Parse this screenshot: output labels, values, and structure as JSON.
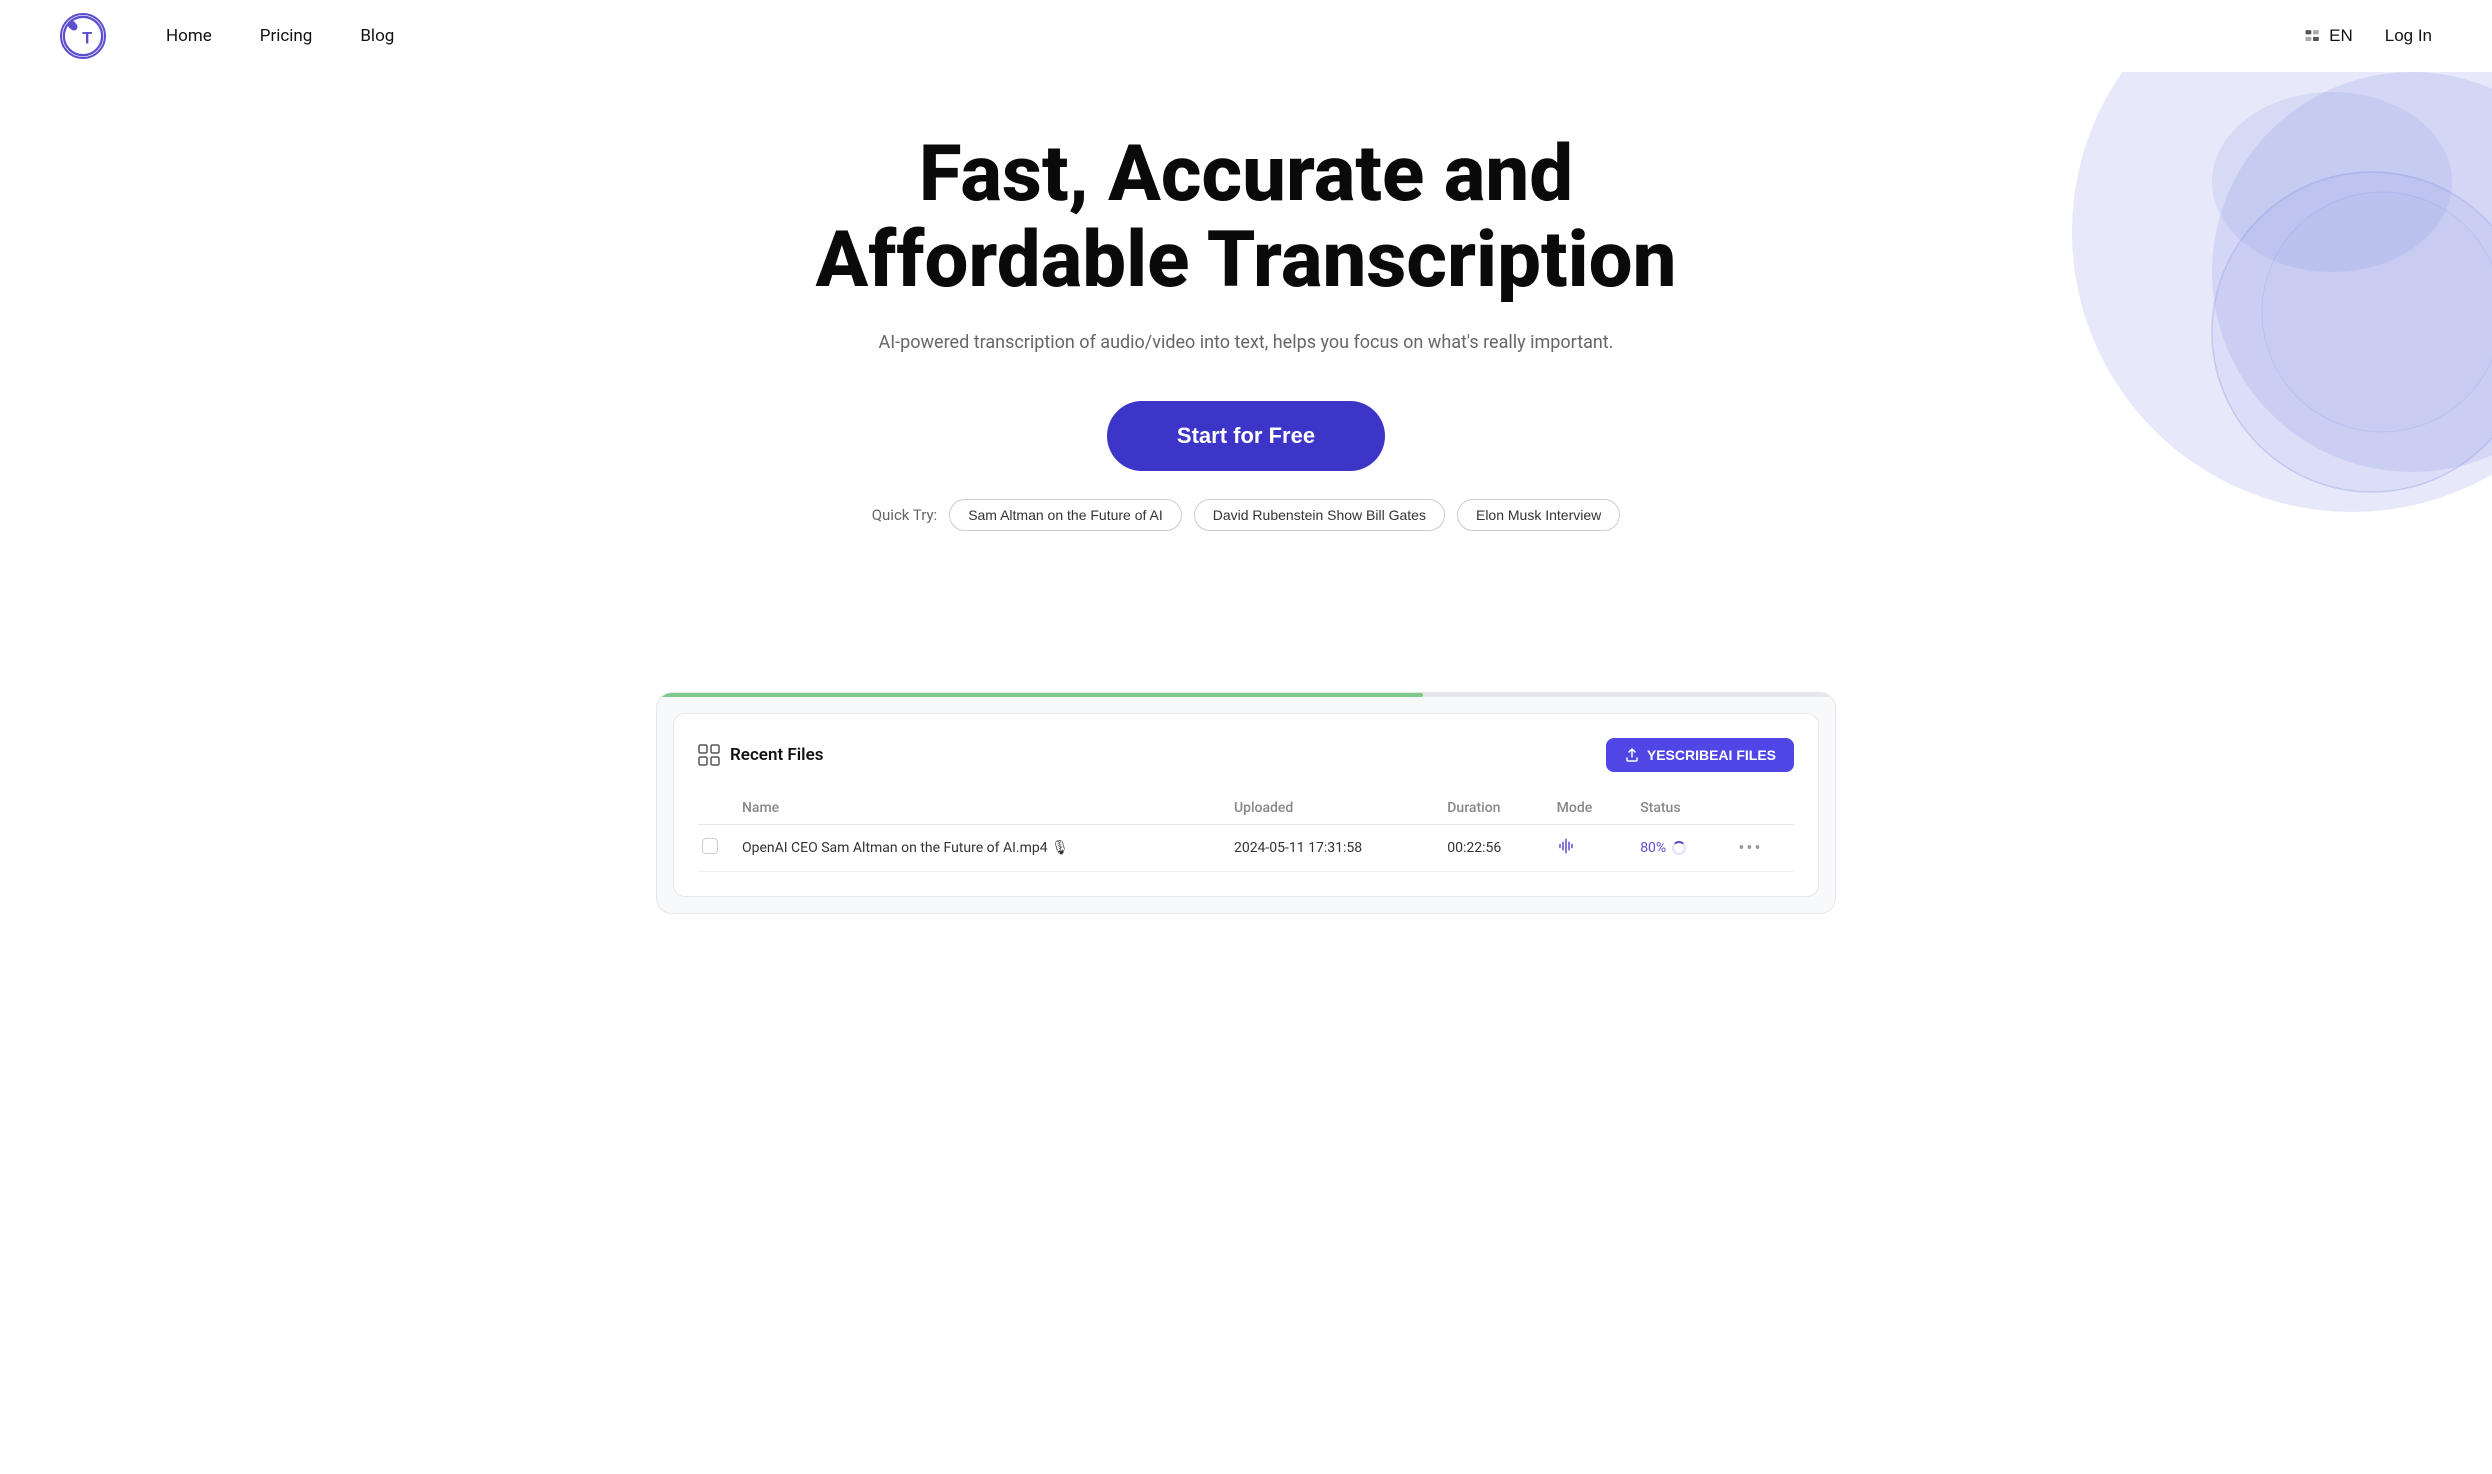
{
  "navbar": {
    "logo_letter": "T",
    "nav_links": [
      {
        "label": "Home",
        "href": "#"
      },
      {
        "label": "Pricing",
        "href": "#"
      },
      {
        "label": "Blog",
        "href": "#"
      }
    ],
    "lang_label": "EN",
    "login_label": "Log In"
  },
  "hero": {
    "headline_line1": "Fast, Accurate and",
    "headline_line2": "Affordable Transcription",
    "subtitle": "AI-powered transcription of audio/video into text, helps you focus on what's really important.",
    "cta_label": "Start for Free",
    "quick_try_label": "Quick Try:",
    "quick_try_chips": [
      {
        "label": "Sam Altman on the Future of AI"
      },
      {
        "label": "David Rubenstein Show Bill Gates"
      },
      {
        "label": "Elon Musk Interview"
      }
    ]
  },
  "dashboard": {
    "recent_files_title": "Recent Files",
    "upload_btn_label": "YESCRIBEAI FILES",
    "table_headers": [
      "",
      "Name",
      "Uploaded",
      "Duration",
      "Mode",
      "Status",
      ""
    ],
    "table_rows": [
      {
        "name": "OpenAI CEO Sam Altman on the Future of AI.mp4",
        "emoji": "🎙",
        "uploaded": "2024-05-11 17:31:58",
        "duration": "00:22:56",
        "mode_icon": "audio",
        "status": "80%",
        "status_type": "loading"
      }
    ]
  },
  "colors": {
    "brand_blue": "#4f46e5",
    "brand_purple": "#5b4fcf",
    "bg_circle1": "rgba(120, 130, 220, 0.35)",
    "bg_circle2": "rgba(150, 160, 230, 0.2)",
    "bg_circle3": "rgba(180, 190, 240, 0.15)"
  }
}
